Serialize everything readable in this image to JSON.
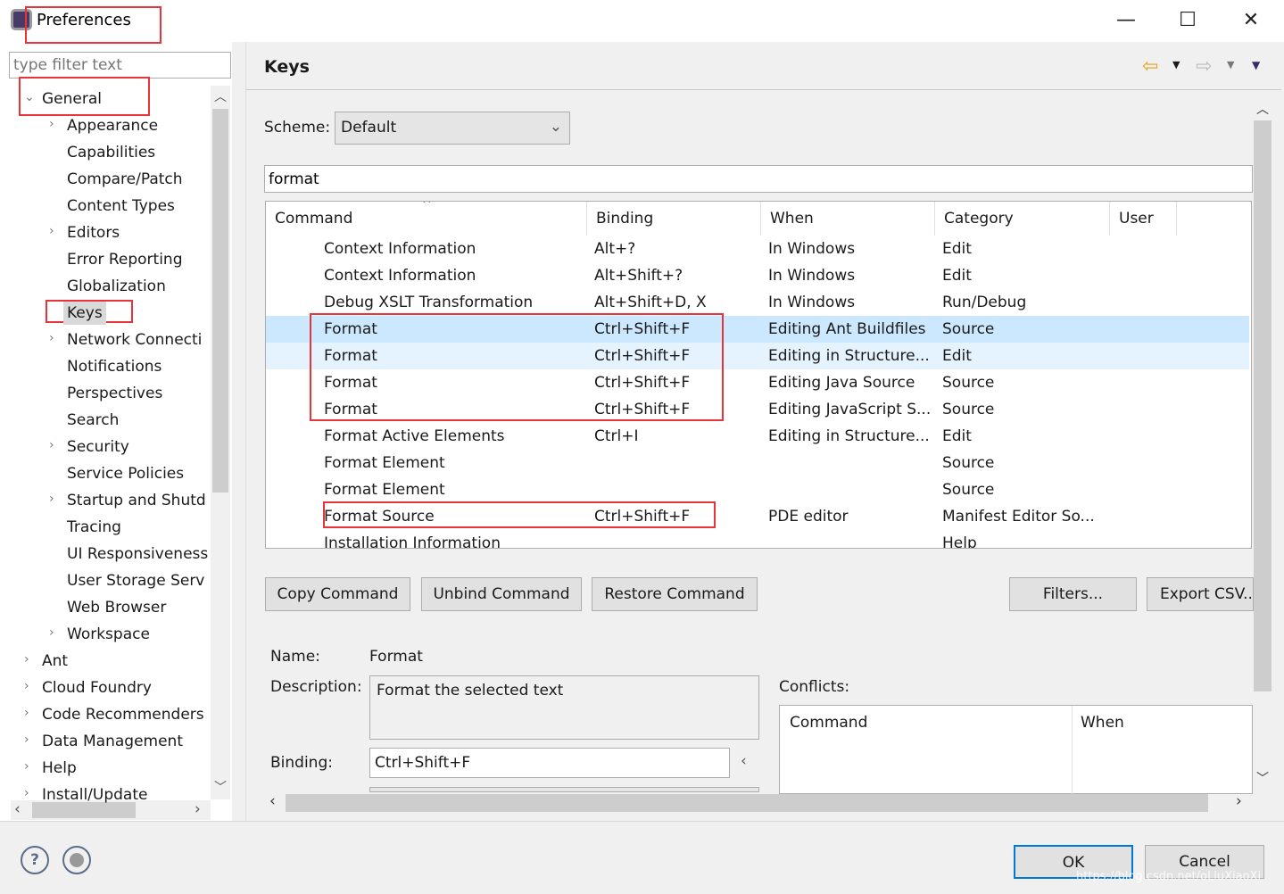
{
  "window": {
    "title": "Preferences",
    "minimize": "—",
    "maximize": "☐",
    "close": "✕"
  },
  "sidebar": {
    "filter_placeholder": "type filter text",
    "items": [
      {
        "label": "General",
        "level": 0,
        "expander": "expanded"
      },
      {
        "label": "Appearance",
        "level": 1,
        "expander": "collapsed"
      },
      {
        "label": "Capabilities",
        "level": 1,
        "expander": "none"
      },
      {
        "label": "Compare/Patch",
        "level": 1,
        "expander": "none"
      },
      {
        "label": "Content Types",
        "level": 1,
        "expander": "none"
      },
      {
        "label": "Editors",
        "level": 1,
        "expander": "collapsed"
      },
      {
        "label": "Error Reporting",
        "level": 1,
        "expander": "none"
      },
      {
        "label": "Globalization",
        "level": 1,
        "expander": "none"
      },
      {
        "label": "Keys",
        "level": 1,
        "expander": "none",
        "selected": true
      },
      {
        "label": "Network Connecti",
        "level": 1,
        "expander": "collapsed"
      },
      {
        "label": "Notifications",
        "level": 1,
        "expander": "none"
      },
      {
        "label": "Perspectives",
        "level": 1,
        "expander": "none"
      },
      {
        "label": "Search",
        "level": 1,
        "expander": "none"
      },
      {
        "label": "Security",
        "level": 1,
        "expander": "collapsed"
      },
      {
        "label": "Service Policies",
        "level": 1,
        "expander": "none"
      },
      {
        "label": "Startup and Shutd",
        "level": 1,
        "expander": "collapsed"
      },
      {
        "label": "Tracing",
        "level": 1,
        "expander": "none"
      },
      {
        "label": "UI Responsiveness",
        "level": 1,
        "expander": "none"
      },
      {
        "label": "User Storage Serv",
        "level": 1,
        "expander": "none"
      },
      {
        "label": "Web Browser",
        "level": 1,
        "expander": "none"
      },
      {
        "label": "Workspace",
        "level": 1,
        "expander": "collapsed"
      },
      {
        "label": "Ant",
        "level": 0,
        "expander": "collapsed"
      },
      {
        "label": "Cloud Foundry",
        "level": 0,
        "expander": "collapsed"
      },
      {
        "label": "Code Recommenders",
        "level": 0,
        "expander": "collapsed"
      },
      {
        "label": "Data Management",
        "level": 0,
        "expander": "collapsed"
      },
      {
        "label": "Help",
        "level": 0,
        "expander": "collapsed"
      },
      {
        "label": "Install/Update",
        "level": 0,
        "expander": "collapsed"
      }
    ]
  },
  "main": {
    "title": "Keys",
    "scheme_label": "Scheme:",
    "scheme_value": "Default",
    "search_value": "format",
    "columns": [
      "Command",
      "Binding",
      "When",
      "Category",
      "User"
    ],
    "rows": [
      [
        "Context Information",
        "Alt+?",
        "In Windows",
        "Edit",
        ""
      ],
      [
        "Context Information",
        "Alt+Shift+?",
        "In Windows",
        "Edit",
        ""
      ],
      [
        "Debug XSLT Transformation",
        "Alt+Shift+D, X",
        "In Windows",
        "Run/Debug",
        ""
      ],
      [
        "Format",
        "Ctrl+Shift+F",
        "Editing Ant Buildfiles",
        "Source",
        ""
      ],
      [
        "Format",
        "Ctrl+Shift+F",
        "Editing in Structure...",
        "Edit",
        ""
      ],
      [
        "Format",
        "Ctrl+Shift+F",
        "Editing Java Source",
        "Source",
        ""
      ],
      [
        "Format",
        "Ctrl+Shift+F",
        "Editing JavaScript S...",
        "Source",
        ""
      ],
      [
        "Format Active Elements",
        "Ctrl+I",
        "Editing in Structure...",
        "Edit",
        ""
      ],
      [
        "Format Element",
        "",
        "",
        "Source",
        ""
      ],
      [
        "Format Element",
        "",
        "",
        "Source",
        ""
      ],
      [
        "Format Source",
        "Ctrl+Shift+F",
        "PDE editor",
        "Manifest Editor So...",
        ""
      ],
      [
        "Installation Information",
        "",
        "",
        "Help",
        ""
      ]
    ],
    "selected_row": 3,
    "buttons": {
      "copy": "Copy Command",
      "unbind": "Unbind Command",
      "restore": "Restore Command",
      "filters": "Filters...",
      "export": "Export CSV..."
    },
    "details": {
      "name_label": "Name:",
      "name_value": "Format",
      "description_label": "Description:",
      "description_value": "Format the selected text",
      "binding_label": "Binding:",
      "binding_value": "Ctrl+Shift+F"
    },
    "conflicts": {
      "label": "Conflicts:",
      "columns": [
        "Command",
        "When"
      ]
    }
  },
  "footer": {
    "ok": "OK",
    "cancel": "Cancel",
    "help_icon": "?",
    "watermark": "https://blog.csdn.net/oLiuXiaoXi"
  },
  "colors": {
    "selection": "#cce8ff",
    "selection_secondary": "#e5f3ff",
    "annotation": "#e8333a",
    "ok_border": "#0078d7"
  }
}
